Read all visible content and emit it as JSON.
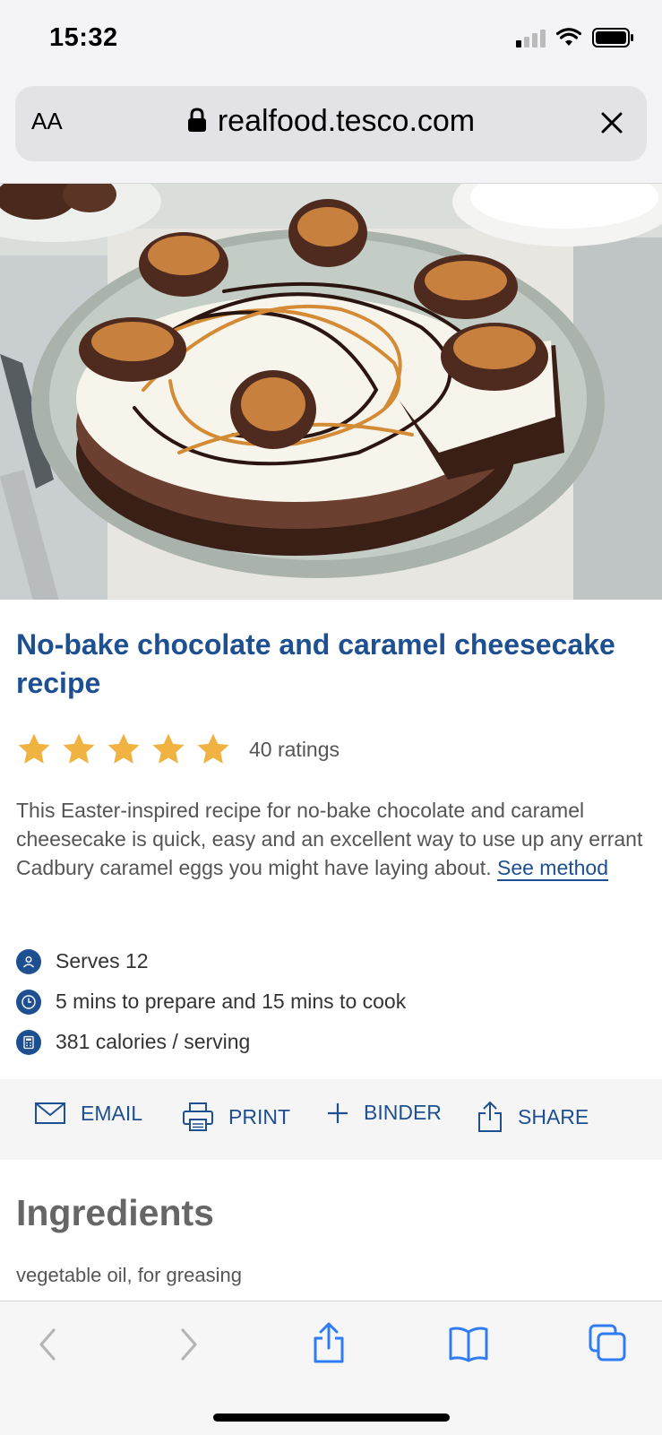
{
  "status_bar": {
    "time": "15:32"
  },
  "browser": {
    "text_size_label": "AA",
    "url": "realfood.tesco.com"
  },
  "recipe": {
    "title": "No-bake chocolate and caramel cheesecake recipe",
    "rating": {
      "stars": 5,
      "max_stars": 5,
      "count_label": "40 ratings"
    },
    "description": "This Easter-inspired recipe for no-bake chocolate and caramel cheesecake is quick, easy and an excellent way to use up any errant Cadbury caramel eggs you might have laying about.",
    "see_method_label": "See method",
    "meta": {
      "serves": "Serves 12",
      "time": "5 mins to prepare and 15 mins to cook",
      "calories": "381 calories / serving"
    }
  },
  "actions": {
    "email": "EMAIL",
    "print": "PRINT",
    "binder": "BINDER",
    "share": "SHARE"
  },
  "ingredients": {
    "heading": "Ingredients",
    "items": [
      "vegetable oil, for greasing"
    ]
  },
  "colors": {
    "brand_blue": "#1d4f91",
    "star_gold": "#f0b341",
    "toolbar_blue": "#2f7cf6"
  }
}
